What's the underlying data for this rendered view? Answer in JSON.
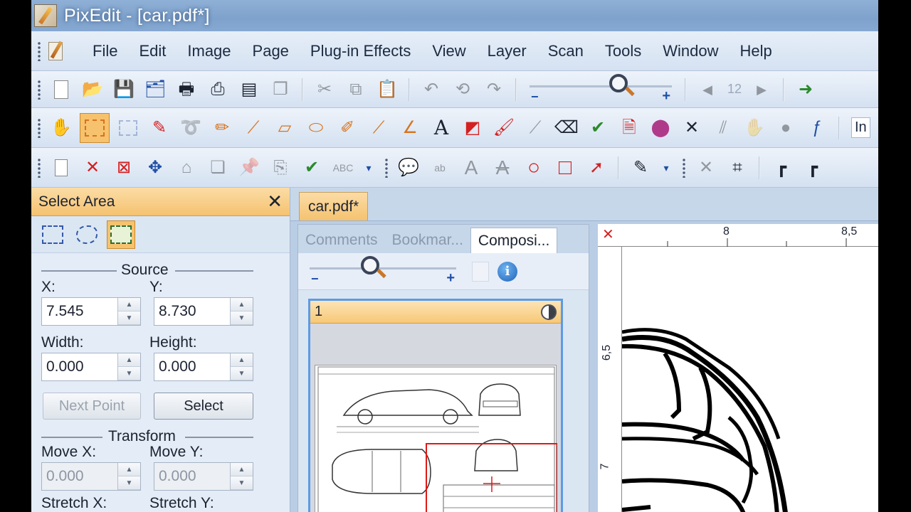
{
  "window": {
    "title": "PixEdit - [car.pdf*]"
  },
  "menu": [
    "File",
    "Edit",
    "Image",
    "Page",
    "Plug-in Effects",
    "View",
    "Layer",
    "Scan",
    "Tools",
    "Window",
    "Help"
  ],
  "toolbar1": {
    "page_number": "12",
    "right_text": "In"
  },
  "select_panel": {
    "title": "Select Area",
    "close": "✕",
    "source_title": "Source",
    "x_label": "X:",
    "x_value": "7.545",
    "y_label": "Y:",
    "y_value": "8.730",
    "width_label": "Width:",
    "width_value": "0.000",
    "height_label": "Height:",
    "height_value": "0.000",
    "next_point": "Next Point",
    "select": "Select",
    "transform_title": "Transform",
    "movex_label": "Move X:",
    "movex_value": "0.000",
    "movey_label": "Move Y:",
    "movey_value": "0.000",
    "stretchx_label": "Stretch X:",
    "stretchy_label": "Stretch Y:"
  },
  "document": {
    "tab": "car.pdf*",
    "subtabs": [
      "Comments",
      "Bookmar...",
      "Composi..."
    ],
    "thumbnail_page": "1",
    "ruler_h": [
      "8",
      "8,5"
    ],
    "ruler_v": [
      "6,5",
      "7"
    ]
  }
}
